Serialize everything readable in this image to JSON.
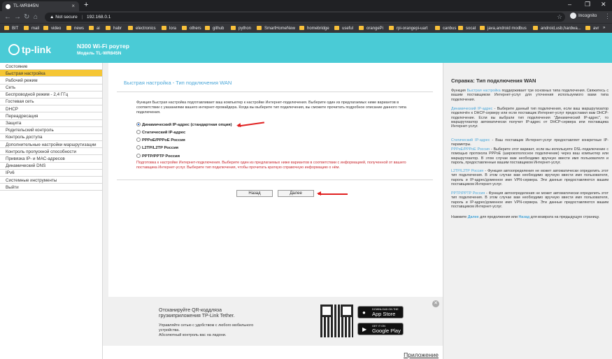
{
  "browser": {
    "tab_title": "TL-WR845N",
    "new_tab": "+",
    "url_warning": "Not secure",
    "url": "192.168.0.1",
    "mode": "Incognito",
    "window_minimize": "–",
    "window_restore": "❐",
    "window_close": "✕",
    "bookmarks": [
      "BIT",
      "mail",
      "video",
      "news",
      "ai",
      "habr",
      "electronics",
      "lora",
      "others",
      "github",
      "python",
      "SmartHomeNew",
      "homebridge",
      "useful",
      "orangePi",
      "rpi-orangepi-uart",
      "canbus",
      "socat",
      "java,android modbus",
      "android,usb,hardwa...",
      "avr"
    ]
  },
  "header": {
    "logo": "tp-link",
    "title": "N300 Wi-Fi роутер",
    "model": "Модель TL-WR845N"
  },
  "sidebar": {
    "items": [
      {
        "label": "Состояние",
        "active": false
      },
      {
        "label": "Быстрая настройка",
        "active": true
      },
      {
        "label": "Рабочий режим",
        "active": false
      },
      {
        "label": "Сеть",
        "active": false
      },
      {
        "label": "Беспроводной режим - 2,4 ГГц",
        "active": false
      },
      {
        "label": "Гостевая сеть",
        "active": false
      },
      {
        "label": "DHCP",
        "active": false
      },
      {
        "label": "Переадресация",
        "active": false
      },
      {
        "label": "Защита",
        "active": false
      },
      {
        "label": "Родительский контроль",
        "active": false
      },
      {
        "label": "Контроль доступа",
        "active": false
      },
      {
        "label": "Дополнительные настройки маршрутизации",
        "active": false
      },
      {
        "label": "Контроль пропускной способности",
        "active": false
      },
      {
        "label": "Привязка IP- и MAC-адресов",
        "active": false
      },
      {
        "label": "Динамический DNS",
        "active": false
      },
      {
        "label": "IPv6",
        "active": false
      },
      {
        "label": "Системные инструменты",
        "active": false
      },
      {
        "label": "Выйти",
        "active": false
      }
    ]
  },
  "main": {
    "title": "Быстрая настройка - Тип подключения WAN",
    "description": "Функция Быстрая настройка подготавливает ваш компьютер к настройке Интернет-подключения. Выберите один из предлагаемых ниже вариантов в соответствии с указаниями вашего интернет-провайдера. Когда вы выберите тип подключения, вы сможете прочитать подробное описание данного типа подключения.",
    "options": [
      {
        "label": "Динамический IP-адрес (стандартная опция)",
        "selected": true
      },
      {
        "label": "Статический IP-адрес",
        "selected": false
      },
      {
        "label": "PPPoE/PPPoE Россия",
        "selected": false
      },
      {
        "label": "L2TP/L2TP Россия",
        "selected": false
      },
      {
        "label": "PPTP/PPTP Россия",
        "selected": false
      }
    ],
    "note": "Подготовка к настройке Интернет-подключения. Выберите один из предлагаемых ниже вариантов в соответствии с информацией, полученной от вашего поставщика Интернет-услуг. Выберите тип подключения, чтобы прочитать краткую справочную информацию о нём.",
    "back_label": "Назад",
    "next_label": "Далее"
  },
  "promo": {
    "line1": "Отсканируйте QR-коддляза грузкиприложения TP-Link Tether.",
    "line2": "Управляйте сетью с удобством с любого мобильного устройства.",
    "line3": "Абсолютный контроль вас на ладони.",
    "appstore_small": "DOWNLOAD ON THE",
    "appstore_big": "App Store",
    "gplay_small": "GET IT ON",
    "gplay_big": "Google Play",
    "app_link": "Приложение"
  },
  "help": {
    "title": "Справка: Тип подключения WAN",
    "p1_a": "Функция ",
    "p1_k": "Быстрая настройка",
    "p1_b": " поддерживает три основных типа подключения. Свяжитесь с вашим поставщиком Интернет-услуг для уточнения используемого вами типа подключения.",
    "p2_k": "Динамический IP-адрес",
    "p2_b": " - Выберите данный тип подключения, если ваш маршрутизатор подключён к DHCP-серверу или если поставщик Интернет-услуг предоставил вам DHCP-подключение. Если вы выбрали тип подключения \"Динамический IP-адрес\", то маршрутизатор автоматически получит IP-адрес от DHCP-сервера или поставщика Интернет-услуг.",
    "p3_k": "Статический IP-адрес",
    "p3_b": " - Ваш поставщик Интернет-услуг предоставляет конкретные IP-параметры.",
    "p4_k": "PPPoE/PPPoE Россия",
    "p4_b": " - Выберите этот вариант, если вы используете DSL-подключение с помощью протокола PPPoE (широкополосное подключение) через ваш компьютер или маршрутизатор. В этом случае вам необходимо вручную ввести имя пользователя и пароль, предоставленные вашим поставщиком Интернет-услуг.",
    "p5_k": "L2TP/L2TP Россия",
    "p5_b": " - Функция автоопределения не может автоматически определить этот тип подключения. В этом случае вам необходимо вручную ввести имя пользователя, пароль и IP-адрес/доменное имя VPN-сервера. Эти данные предоставляются вашим поставщиком Интернет-услуг.",
    "p6_k": "PPTP/PPTP Россия",
    "p6_b": " - Функция автоопределения не может автоматически определить этот тип подключения. В этом случае вам необходимо вручную ввести имя пользователя, пароль и IP-адрес/доменное имя VPN-сервера. Эти данные предоставляются вашим поставщиком Интернет-услуг.",
    "p7_a": "Нажмите ",
    "p7_k1": "Далее",
    "p7_m": " для продолжения или ",
    "p7_k2": "Назад",
    "p7_b": " для возврата на предыдущую страницу."
  },
  "colors": {
    "accent": "#4acbd6",
    "active_menu": "#f5c635",
    "link": "#4aa6d8",
    "note": "#c8282e"
  }
}
